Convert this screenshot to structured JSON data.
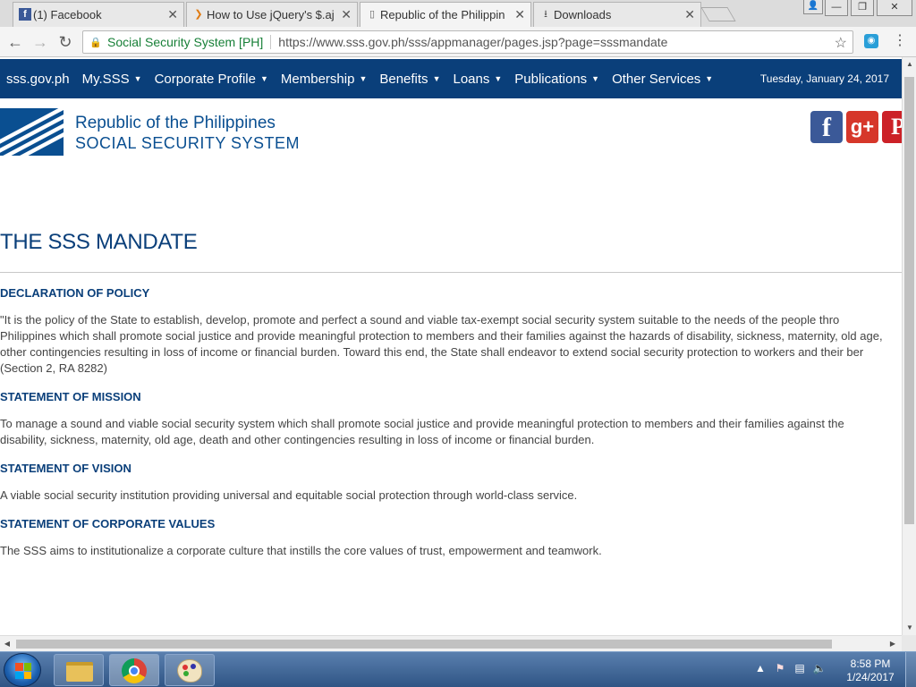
{
  "browser": {
    "tabs": [
      {
        "title": "(1) Facebook",
        "icon": "facebook-icon"
      },
      {
        "title": "How to Use jQuery's $.aj",
        "icon": "jquery-icon"
      },
      {
        "title": "Republic of the Philippin",
        "icon": "page-icon"
      },
      {
        "title": "Downloads",
        "icon": "download-icon"
      }
    ],
    "omnibox": {
      "site_name": "Social Security System [PH]",
      "url": "https://www.sss.gov.ph/sss/appmanager/pages.jsp?page=sssmandate"
    }
  },
  "nav": {
    "items": [
      {
        "label": "sss.gov.ph",
        "dropdown": false
      },
      {
        "label": "My.SSS",
        "dropdown": true
      },
      {
        "label": "Corporate Profile",
        "dropdown": true
      },
      {
        "label": "Membership",
        "dropdown": true
      },
      {
        "label": "Benefits",
        "dropdown": true
      },
      {
        "label": "Loans",
        "dropdown": true
      },
      {
        "label": "Publications",
        "dropdown": true
      },
      {
        "label": "Other Services",
        "dropdown": true
      }
    ],
    "date": "Tuesday, January 24, 2017"
  },
  "header": {
    "org_line1": "Republic of the Philippines",
    "org_line2": "SOCIAL SECURITY SYSTEM",
    "social": [
      "facebook-icon",
      "google-plus-icon",
      "pinterest-icon"
    ]
  },
  "content": {
    "page_title": "THE SSS MANDATE",
    "sections": [
      {
        "title": "DECLARATION OF POLICY",
        "lines": [
          "\"It is the policy of the State to establish, develop, promote and perfect a sound and viable tax-exempt social security system suitable to the needs of the people thro",
          "Philippines which shall promote social justice and provide meaningful protection to members and their families against the hazards of disability, sickness, maternity, old age,",
          "other contingencies resulting in loss of income or financial burden. Toward this end, the State shall endeavor to extend social security protection to workers and their ber",
          "(Section 2, RA 8282)"
        ]
      },
      {
        "title": "STATEMENT OF MISSION",
        "lines": [
          "To manage a sound and viable social security system which shall promote social justice and provide meaningful protection to members and their families against the",
          "disability, sickness, maternity, old age, death and other contingencies resulting in loss of income or financial burden."
        ]
      },
      {
        "title": "STATEMENT OF VISION",
        "lines": [
          "A viable social security institution providing universal and equitable social protection through world-class service."
        ]
      },
      {
        "title": "STATEMENT OF CORPORATE VALUES",
        "lines": [
          "The SSS aims to institutionalize a corporate culture that instills the core values of trust, empowerment and teamwork."
        ]
      }
    ]
  },
  "taskbar": {
    "time": "8:58 PM",
    "date": "1/24/2017"
  },
  "colors": {
    "nav_bg": "#0a3f7a",
    "heading": "#0a3f7a",
    "secure_green": "#188038"
  }
}
